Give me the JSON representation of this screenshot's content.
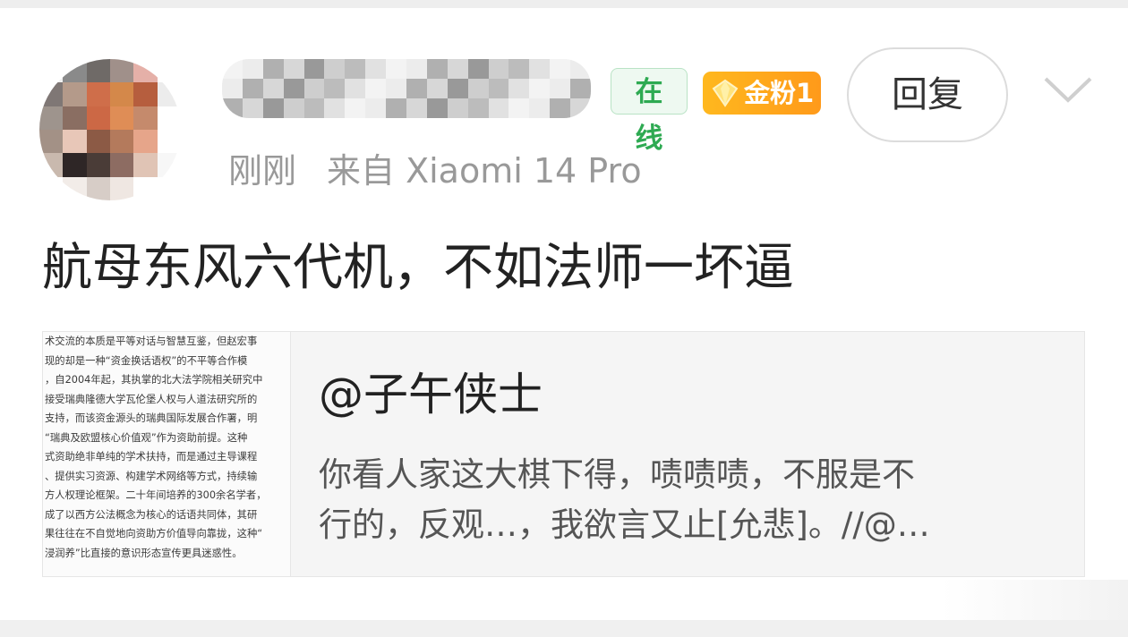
{
  "user": {
    "online_badge": "在线",
    "fan_badge": "金粉1",
    "time": "刚刚",
    "source": "来自 Xiaomi 14 Pro"
  },
  "actions": {
    "reply_label": "回复"
  },
  "post": {
    "text": "航母东风六代机，不如法师一坏逼"
  },
  "quote": {
    "handle": "@子午侠士",
    "lines": [
      "你看人家这大棋下得，啧啧啧，不服是不",
      "行的，反观…，我欲言又止[允悲]。//@…"
    ],
    "thumbnail_lines": [
      "术交流的本质是平等对话与智慧互鉴，但赵宏事",
      "现的却是一种“资金换话语权”的不平等合作模",
      "，自2004年起，其执掌的北大法学院相关研究中",
      "接受瑞典隆德大学瓦伦堡人权与人道法研究所的",
      "支持，而该资金源头的瑞典国际发展合作署，明",
      "“瑞典及欧盟核心价值观”作为资助前提。这种",
      "式资助绝非单纯的学术扶持，而是通过主导课程",
      "、提供实习资源、构建学术网络等方式，持续输",
      "方人权理论框架。二十年间培养的300余名学者，",
      "成了以西方公法概念为核心的话语共同体，其研",
      "果往往在不自觉地向资助方价值导向靠拢，这种“",
      "浸润养”比直接的意识形态宣传更具迷惑性。"
    ]
  }
}
